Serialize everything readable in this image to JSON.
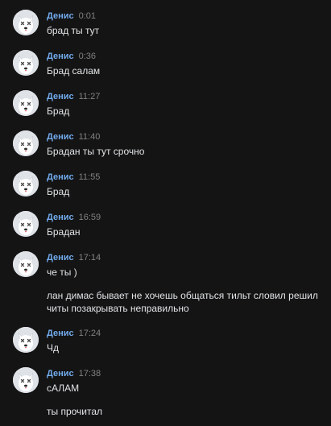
{
  "author": "Денис",
  "avatar_icon": "dog-avatar-icon",
  "colors": {
    "background": "#141414",
    "author": "#71aaeb",
    "time": "#828282",
    "text": "#e1e3e6"
  },
  "messages": [
    {
      "time": "0:01",
      "texts": [
        "брад ты тут"
      ]
    },
    {
      "time": "0:36",
      "texts": [
        "Брад салам"
      ]
    },
    {
      "time": "11:27",
      "texts": [
        "Брад"
      ]
    },
    {
      "time": "11:40",
      "texts": [
        "Брадан ты тут срочно"
      ]
    },
    {
      "time": "11:55",
      "texts": [
        "Брад"
      ]
    },
    {
      "time": "16:59",
      "texts": [
        "Брадан"
      ]
    },
    {
      "time": "17:14",
      "texts": [
        "че ты )",
        "лан димас бывает не хочешь общаться тильт словил решил читы позакрывать неправильно"
      ]
    },
    {
      "time": "17:24",
      "texts": [
        "Чд"
      ]
    },
    {
      "time": "17:38",
      "texts": [
        "сАЛАМ",
        "ты прочитал"
      ]
    }
  ]
}
